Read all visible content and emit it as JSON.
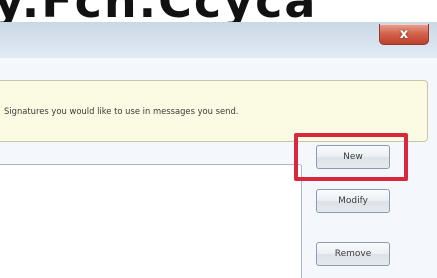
{
  "banner": {
    "caption_fragment": "y.Fcn.Ccyca"
  },
  "window": {
    "close_glyph": "x"
  },
  "info": {
    "text": "Signatures you would like to use in messages you send."
  },
  "buttons": {
    "new_label": "New",
    "modify_label": "Modify",
    "remove_label": "Remove"
  },
  "colors": {
    "highlight": "#d7283d",
    "info_background": "#fbfbe3",
    "close_button": "#c0412c"
  }
}
